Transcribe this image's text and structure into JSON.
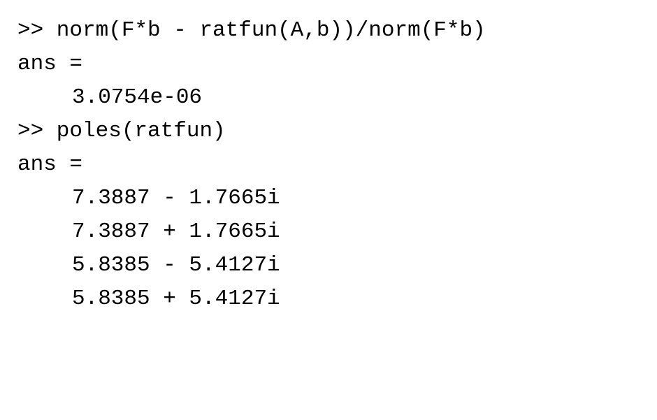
{
  "lines": {
    "l1": ">> norm(F*b - ratfun(A,b))/norm(F*b)",
    "l2": "ans =",
    "l3": "3.0754e-06",
    "l4": "",
    "l5": ">> poles(ratfun)",
    "l6": "ans =",
    "l7": "7.3887 - 1.7665i",
    "l8": "7.3887 + 1.7665i",
    "l9": "5.8385 - 5.4127i",
    "l10": "5.8385 + 5.4127i"
  }
}
